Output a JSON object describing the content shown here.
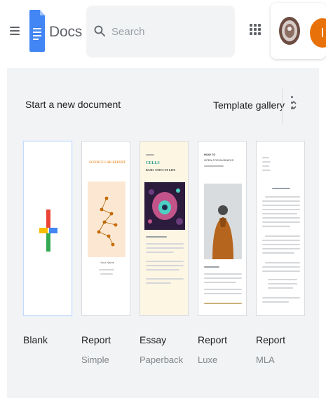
{
  "header": {
    "app_title": "Docs",
    "search_placeholder": "Search",
    "user_initial": "I"
  },
  "icons": {
    "menu": "menu-icon",
    "logo": "docs-logo-icon",
    "search": "search-icon",
    "apps": "apps-grid-icon",
    "org": "organization-avatar",
    "unfold": "unfold-icon",
    "more": "more-vert-icon"
  },
  "colors": {
    "docs_blue": "#4285f4",
    "avatar_orange": "#e8710a",
    "panel_bg": "#f1f3f4"
  },
  "templates_section": {
    "title": "Start a new document",
    "gallery_label": "Template gallery"
  },
  "templates": [
    {
      "title": "Blank",
      "subtitle": ""
    },
    {
      "title": "Report",
      "subtitle": "Simple",
      "thumb_heading": "SCIENCE LAB REPORT",
      "thumb_caption": "Your Name"
    },
    {
      "title": "Essay",
      "subtitle": "Paperback",
      "thumb_heading": "CELLS",
      "thumb_sub": "BASIC UNITS OF LIFE"
    },
    {
      "title": "Report",
      "subtitle": "Luxe",
      "thumb_heading": "HOW TO",
      "thumb_sub": "OPEN FOR BUSINESS"
    },
    {
      "title": "Report",
      "subtitle": "MLA"
    }
  ]
}
